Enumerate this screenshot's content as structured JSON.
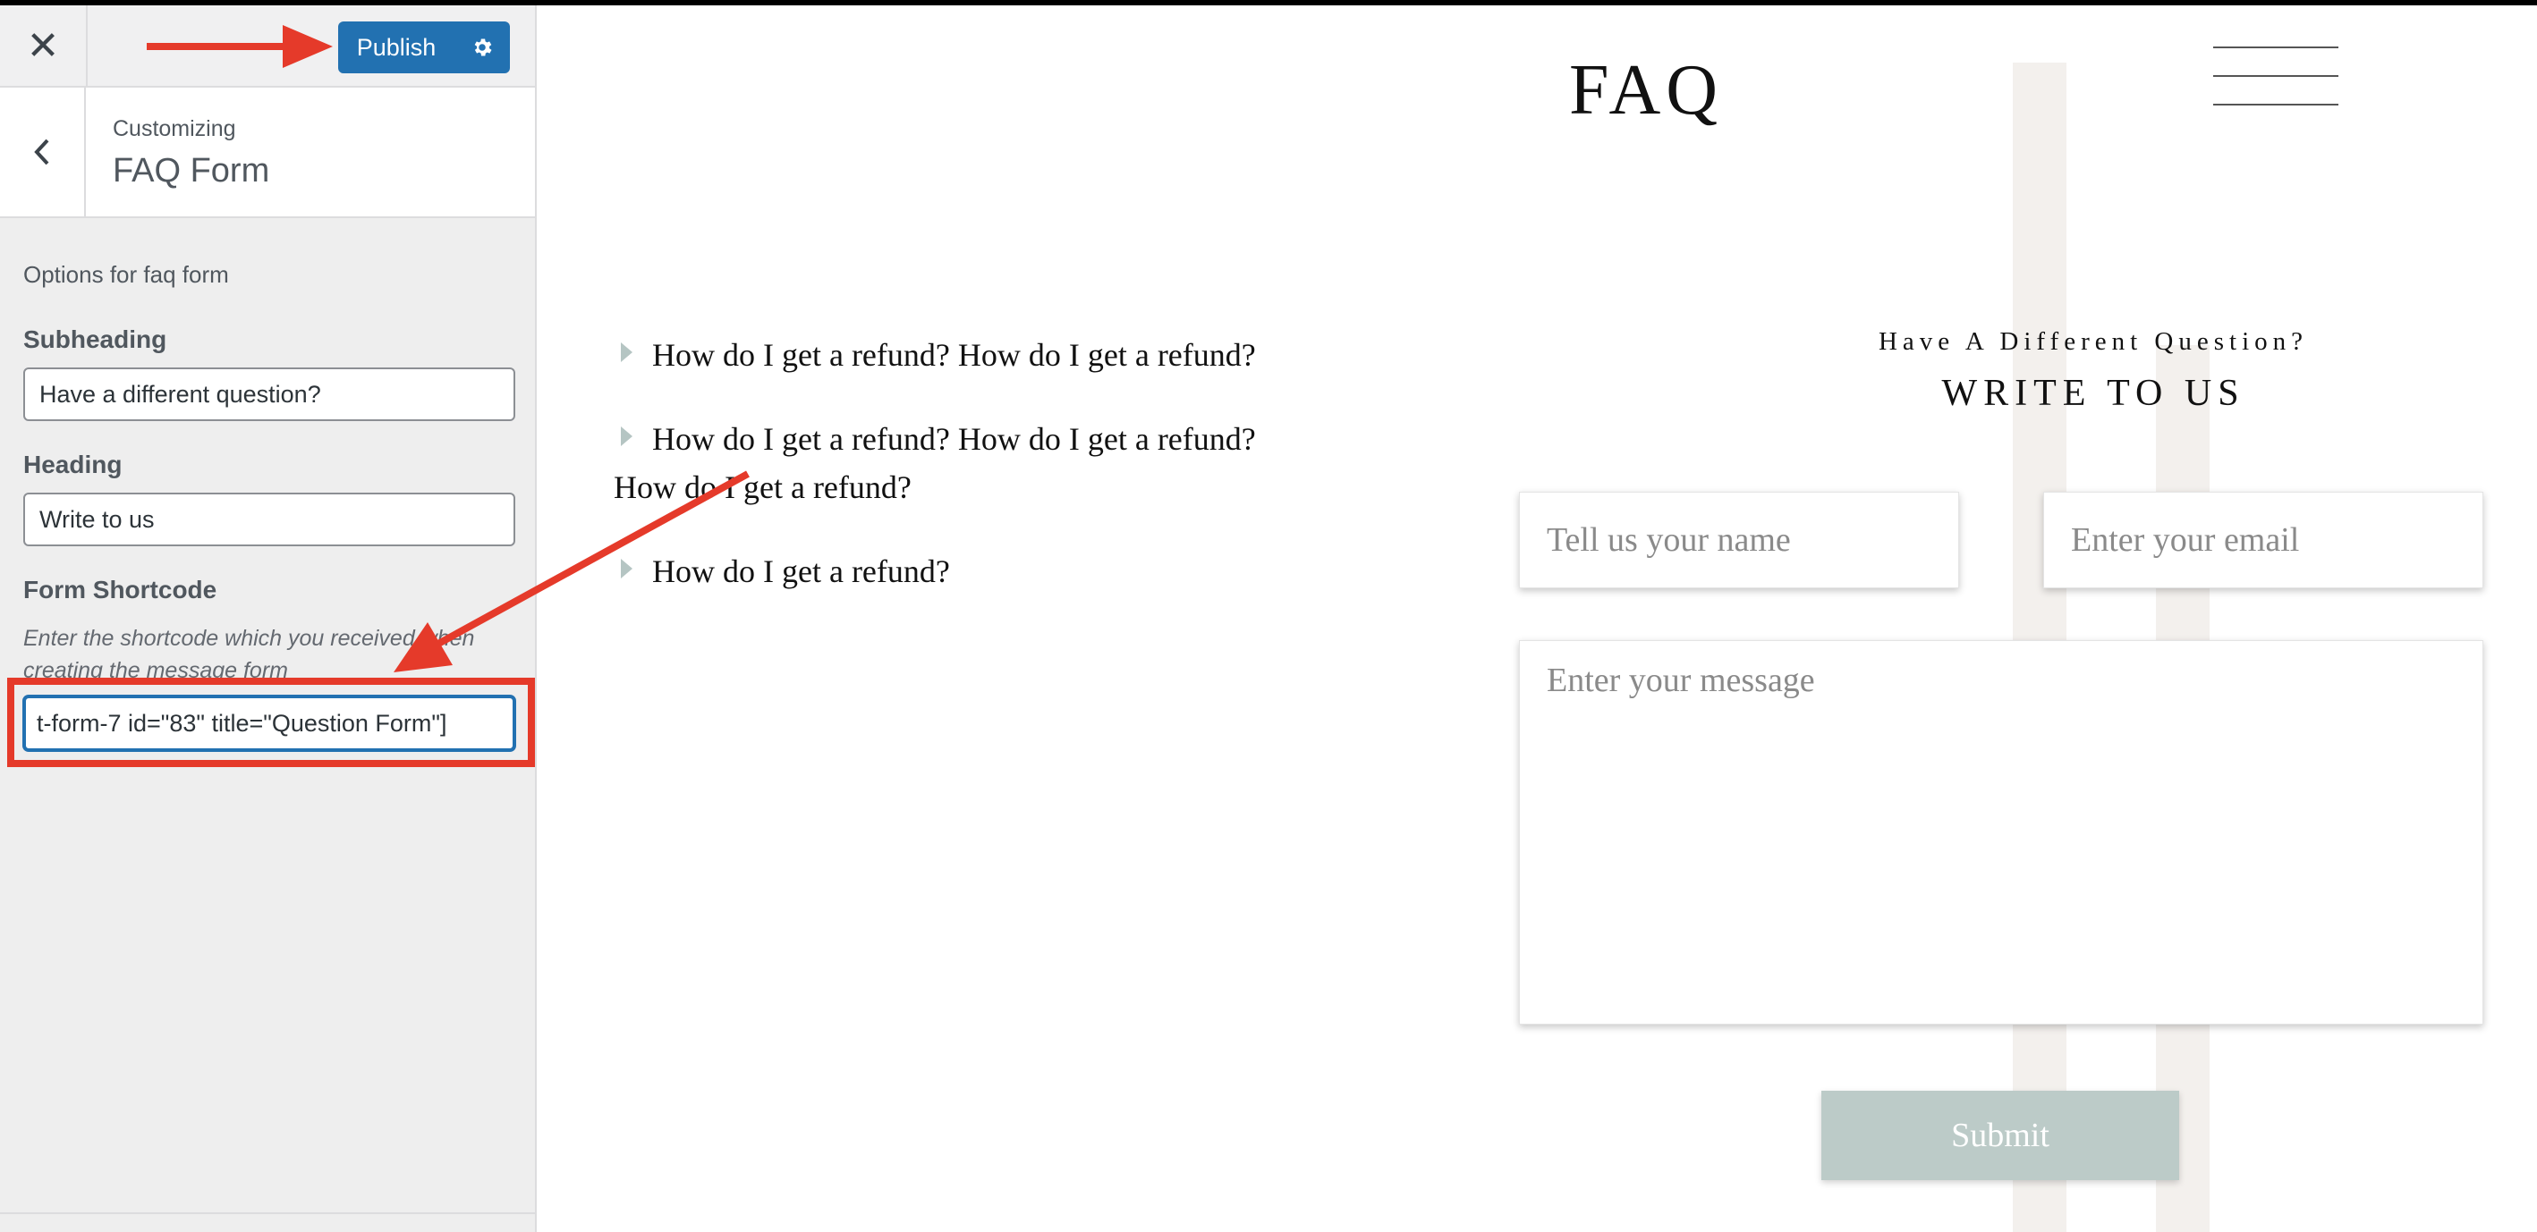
{
  "sidebar": {
    "close_icon": "close-icon",
    "publish_label": "Publish",
    "gear_icon": "gear-icon",
    "back_icon": "chevron-left-icon",
    "customizing_label": "Customizing",
    "section_title": "FAQ Form",
    "options_description": "Options for faq form",
    "subheading_label": "Subheading",
    "subheading_value": "Have a different question?",
    "heading_label": "Heading",
    "heading_value": "Write to us",
    "shortcode_label": "Form Shortcode",
    "shortcode_hint": "Enter the shortcode which you received when creating the message form",
    "shortcode_value": "t-form-7 id=\"83\" title=\"Question Form\"]"
  },
  "preview": {
    "site_title": "FAQ",
    "menu_icon": "hamburger-menu-icon",
    "faq_items": [
      "How do I get a refund? How do I get a refund?",
      "How do I get a refund? How do I get a refund? How do I get a refund?",
      "How do I get a refund?"
    ],
    "form": {
      "subheading": "Have A Different Question?",
      "heading": "WRITE TO US",
      "name_placeholder": "Tell us your name",
      "email_placeholder": "Enter your email",
      "message_placeholder": "Enter your message",
      "submit_label": "Submit"
    }
  },
  "colors": {
    "publish_blue": "#2271b1",
    "annotation_red": "#e53a2a",
    "submit_bg": "#bccbc8"
  }
}
